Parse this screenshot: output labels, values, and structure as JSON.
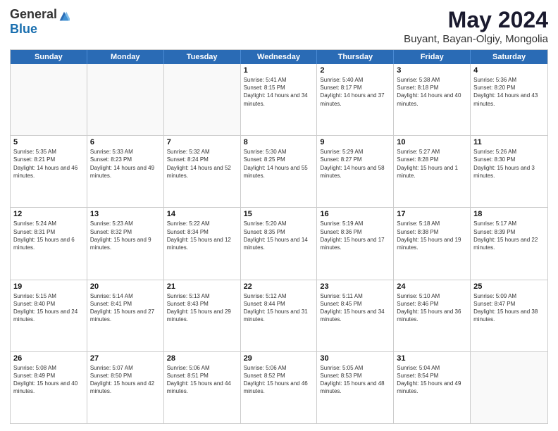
{
  "header": {
    "logo_general": "General",
    "logo_blue": "Blue",
    "main_title": "May 2024",
    "subtitle": "Buyant, Bayan-Olgiy, Mongolia"
  },
  "calendar": {
    "days_of_week": [
      "Sunday",
      "Monday",
      "Tuesday",
      "Wednesday",
      "Thursday",
      "Friday",
      "Saturday"
    ],
    "rows": [
      [
        {
          "day": "",
          "empty": true
        },
        {
          "day": "",
          "empty": true
        },
        {
          "day": "",
          "empty": true
        },
        {
          "day": "1",
          "sunrise": "5:41 AM",
          "sunset": "8:15 PM",
          "daylight": "14 hours and 34 minutes."
        },
        {
          "day": "2",
          "sunrise": "5:40 AM",
          "sunset": "8:17 PM",
          "daylight": "14 hours and 37 minutes."
        },
        {
          "day": "3",
          "sunrise": "5:38 AM",
          "sunset": "8:18 PM",
          "daylight": "14 hours and 40 minutes."
        },
        {
          "day": "4",
          "sunrise": "5:36 AM",
          "sunset": "8:20 PM",
          "daylight": "14 hours and 43 minutes."
        }
      ],
      [
        {
          "day": "5",
          "sunrise": "5:35 AM",
          "sunset": "8:21 PM",
          "daylight": "14 hours and 46 minutes."
        },
        {
          "day": "6",
          "sunrise": "5:33 AM",
          "sunset": "8:23 PM",
          "daylight": "14 hours and 49 minutes."
        },
        {
          "day": "7",
          "sunrise": "5:32 AM",
          "sunset": "8:24 PM",
          "daylight": "14 hours and 52 minutes."
        },
        {
          "day": "8",
          "sunrise": "5:30 AM",
          "sunset": "8:25 PM",
          "daylight": "14 hours and 55 minutes."
        },
        {
          "day": "9",
          "sunrise": "5:29 AM",
          "sunset": "8:27 PM",
          "daylight": "14 hours and 58 minutes."
        },
        {
          "day": "10",
          "sunrise": "5:27 AM",
          "sunset": "8:28 PM",
          "daylight": "15 hours and 1 minute."
        },
        {
          "day": "11",
          "sunrise": "5:26 AM",
          "sunset": "8:30 PM",
          "daylight": "15 hours and 3 minutes."
        }
      ],
      [
        {
          "day": "12",
          "sunrise": "5:24 AM",
          "sunset": "8:31 PM",
          "daylight": "15 hours and 6 minutes."
        },
        {
          "day": "13",
          "sunrise": "5:23 AM",
          "sunset": "8:32 PM",
          "daylight": "15 hours and 9 minutes."
        },
        {
          "day": "14",
          "sunrise": "5:22 AM",
          "sunset": "8:34 PM",
          "daylight": "15 hours and 12 minutes."
        },
        {
          "day": "15",
          "sunrise": "5:20 AM",
          "sunset": "8:35 PM",
          "daylight": "15 hours and 14 minutes."
        },
        {
          "day": "16",
          "sunrise": "5:19 AM",
          "sunset": "8:36 PM",
          "daylight": "15 hours and 17 minutes."
        },
        {
          "day": "17",
          "sunrise": "5:18 AM",
          "sunset": "8:38 PM",
          "daylight": "15 hours and 19 minutes."
        },
        {
          "day": "18",
          "sunrise": "5:17 AM",
          "sunset": "8:39 PM",
          "daylight": "15 hours and 22 minutes."
        }
      ],
      [
        {
          "day": "19",
          "sunrise": "5:15 AM",
          "sunset": "8:40 PM",
          "daylight": "15 hours and 24 minutes."
        },
        {
          "day": "20",
          "sunrise": "5:14 AM",
          "sunset": "8:41 PM",
          "daylight": "15 hours and 27 minutes."
        },
        {
          "day": "21",
          "sunrise": "5:13 AM",
          "sunset": "8:43 PM",
          "daylight": "15 hours and 29 minutes."
        },
        {
          "day": "22",
          "sunrise": "5:12 AM",
          "sunset": "8:44 PM",
          "daylight": "15 hours and 31 minutes."
        },
        {
          "day": "23",
          "sunrise": "5:11 AM",
          "sunset": "8:45 PM",
          "daylight": "15 hours and 34 minutes."
        },
        {
          "day": "24",
          "sunrise": "5:10 AM",
          "sunset": "8:46 PM",
          "daylight": "15 hours and 36 minutes."
        },
        {
          "day": "25",
          "sunrise": "5:09 AM",
          "sunset": "8:47 PM",
          "daylight": "15 hours and 38 minutes."
        }
      ],
      [
        {
          "day": "26",
          "sunrise": "5:08 AM",
          "sunset": "8:49 PM",
          "daylight": "15 hours and 40 minutes."
        },
        {
          "day": "27",
          "sunrise": "5:07 AM",
          "sunset": "8:50 PM",
          "daylight": "15 hours and 42 minutes."
        },
        {
          "day": "28",
          "sunrise": "5:06 AM",
          "sunset": "8:51 PM",
          "daylight": "15 hours and 44 minutes."
        },
        {
          "day": "29",
          "sunrise": "5:06 AM",
          "sunset": "8:52 PM",
          "daylight": "15 hours and 46 minutes."
        },
        {
          "day": "30",
          "sunrise": "5:05 AM",
          "sunset": "8:53 PM",
          "daylight": "15 hours and 48 minutes."
        },
        {
          "day": "31",
          "sunrise": "5:04 AM",
          "sunset": "8:54 PM",
          "daylight": "15 hours and 49 minutes."
        },
        {
          "day": "",
          "empty": true
        }
      ]
    ]
  }
}
